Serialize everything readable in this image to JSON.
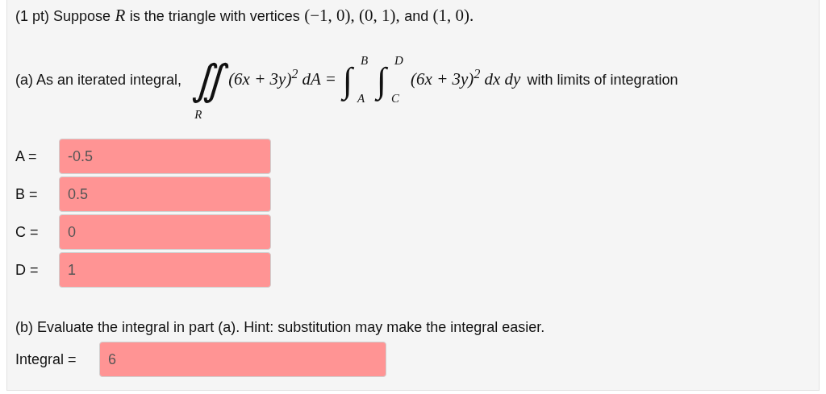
{
  "statement": [
    {
      "kind": "text",
      "text": "(1 pt) Suppose"
    },
    {
      "kind": "math",
      "text": "*R*"
    },
    {
      "kind": "text",
      "text": "is the triangle with vertices"
    },
    {
      "kind": "math",
      "text": "(−1, 0), (0, 1),"
    },
    {
      "kind": "text",
      "text": "and"
    },
    {
      "kind": "math",
      "text": "(1, 0)."
    }
  ],
  "part_a": {
    "label": "(a) As an iterated integral,",
    "double_integral": {
      "sign": "∬",
      "region": "R"
    },
    "integrand_left": "(6x + 3y)$^{2}$ dA =",
    "integrals": [
      {
        "sign": "∫",
        "upper": "B",
        "lower": "A"
      },
      {
        "sign": "∫",
        "upper": "D",
        "lower": "C"
      }
    ],
    "integrand_right": "(6x + 3y)$^{2}$ dx dy",
    "tail": "with limits of integration"
  },
  "fields": [
    {
      "label": "A =",
      "value": "-0.5",
      "correct": false
    },
    {
      "label": "B =",
      "value": "0.5",
      "correct": false
    },
    {
      "label": "C =",
      "value": "0",
      "correct": false
    },
    {
      "label": "D =",
      "value": "1",
      "correct": false
    }
  ],
  "part_b": {
    "text": "(b) Evaluate the integral in part (a). Hint: substitution may make the integral easier.",
    "field": {
      "label": "Integral =",
      "value": "6",
      "correct": false
    }
  }
}
